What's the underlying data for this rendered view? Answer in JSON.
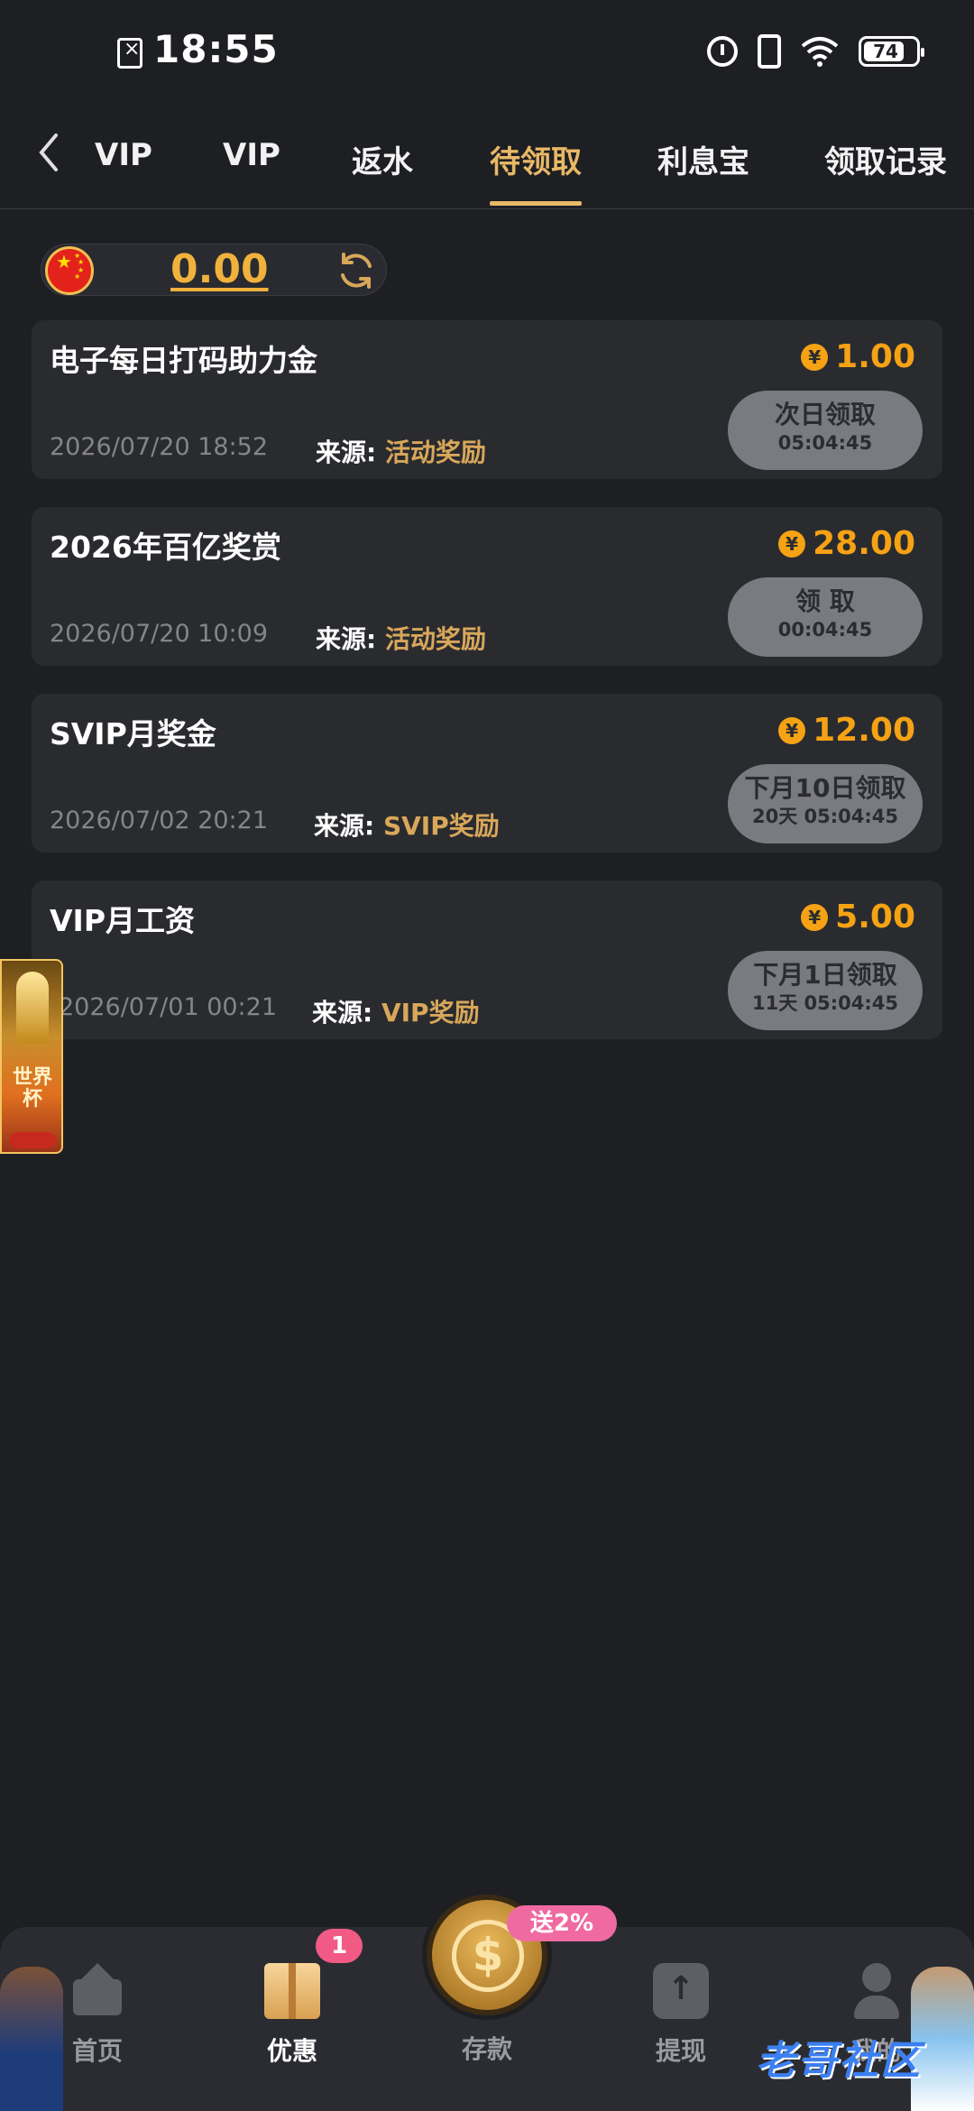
{
  "status_bar": {
    "time": "18:55",
    "battery": "74"
  },
  "tabs": [
    {
      "label": "VIP"
    },
    {
      "label": "VIP"
    },
    {
      "label": "返水"
    },
    {
      "label": "待领取"
    },
    {
      "label": "利息宝"
    },
    {
      "label": "领取记录"
    }
  ],
  "balance": {
    "value": "0.00"
  },
  "cards": [
    {
      "title": "电子每日打码助力金",
      "amount": "1.00",
      "date": "2026/07/20 18:52",
      "source_label": "来源: ",
      "source_value": "活动奖励",
      "button_label": "次日领取",
      "button_timer": "05:04:45"
    },
    {
      "title": "2026年百亿奖赏",
      "amount": "28.00",
      "date": "2026/07/20 10:09",
      "source_label": "来源: ",
      "source_value": "活动奖励",
      "button_label": "领 取",
      "button_timer": "00:04:45"
    },
    {
      "title": "SVIP月奖金",
      "amount": "12.00",
      "date": "2026/07/02 20:21",
      "source_label": "来源: ",
      "source_value": "SVIP奖励",
      "button_label": "下月10日领取",
      "button_timer": "20天 05:04:45"
    },
    {
      "title": "VIP月工资",
      "amount": "5.00",
      "date": "2026/07/01 00:21",
      "source_label": "来源: ",
      "source_value": "VIP奖励",
      "button_label": "下月1日领取",
      "button_timer": "11天 05:04:45"
    }
  ],
  "currency_symbol": "¥",
  "side_banner": {
    "title": "世界杯"
  },
  "bottom_nav": {
    "home": "首页",
    "promo": "优惠",
    "promo_badge": "1",
    "deposit": "存款",
    "deposit_tag": "送2%",
    "withdraw": "提现",
    "profile": "我的"
  },
  "watermark": "老哥社区",
  "colors": {
    "background": "#1e1f23",
    "card": "#2a2b2f",
    "accent_gold": "#e8b866",
    "amount_orange": "#f5a214",
    "button_gray": "#7a7b80",
    "badge_pink": "#f25a86"
  }
}
